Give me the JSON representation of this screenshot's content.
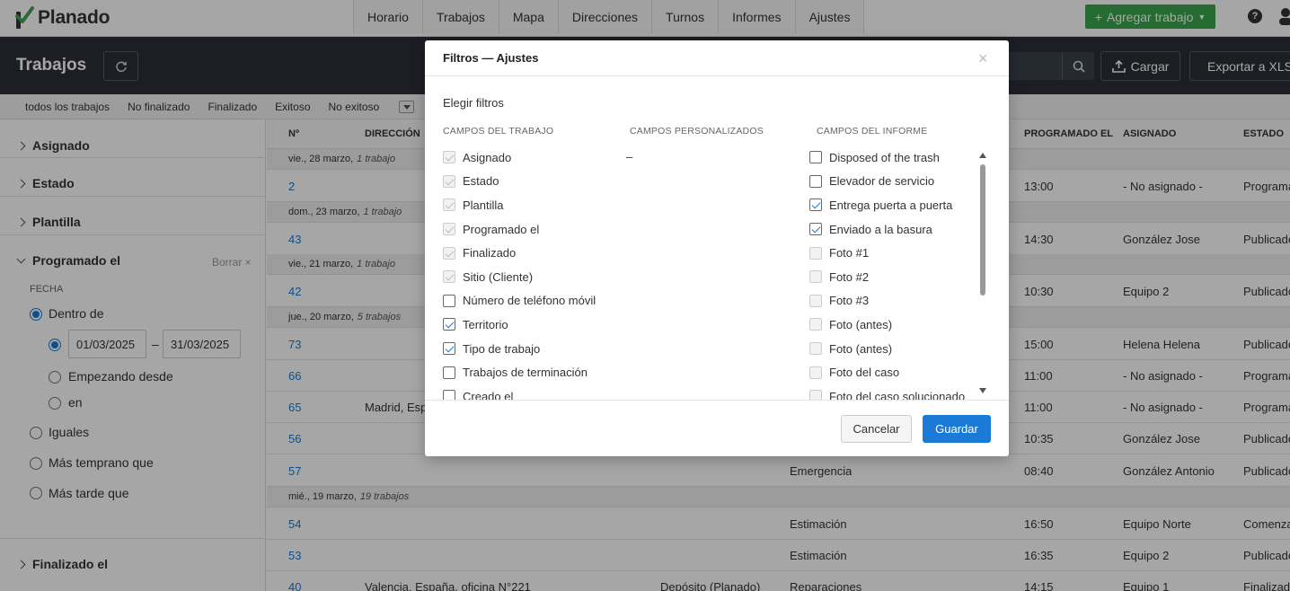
{
  "app": {
    "name": "Planado"
  },
  "nav": {
    "tabs": [
      "Horario",
      "Trabajos",
      "Mapa",
      "Direcciones",
      "Turnos",
      "Informes",
      "Ajustes"
    ],
    "add_job": "Agregar trabajo",
    "help": "?"
  },
  "header": {
    "title": "Trabajos",
    "upload": "Cargar",
    "export": "Exportar a XLS"
  },
  "filters": {
    "chips": [
      "todos los trabajos",
      "No finalizado",
      "Finalizado",
      "Exitoso",
      "No exitoso"
    ]
  },
  "left": {
    "assigned": "Asignado",
    "status": "Estado",
    "template": "Plantilla",
    "scheduled": "Programado el",
    "clear": "Borrar ×",
    "date_label": "FECHA",
    "within": "Dentro de",
    "date_from": "01/03/2025",
    "date_sep": "–",
    "date_to": "31/03/2025",
    "starting": "Empezando desde",
    "on": "en",
    "equals": "Iguales",
    "earlier": "Más temprano que",
    "later": "Más tarde que",
    "finished": "Finalizado el"
  },
  "table": {
    "headers": {
      "num": "Nº",
      "address": "DIRECCIÓN",
      "scheduled": "PROGRAMADO EL",
      "assigned": "ASIGNADO",
      "status": "ESTADO"
    },
    "groups": [
      {
        "date": "vie., 28 marzo,",
        "count": "1 trabajo"
      },
      {
        "date": "dom., 23 marzo,",
        "count": "1 trabajo"
      },
      {
        "date": "vie., 21 marzo,",
        "count": "1 trabajo"
      },
      {
        "date": "jue., 20 marzo,",
        "count": "5 trabajos"
      },
      {
        "date": "mié., 19 marzo,",
        "count": "19 trabajos"
      }
    ],
    "rows": [
      {
        "num": "2",
        "address": "",
        "site": "",
        "type": "",
        "time": "13:00",
        "assignee": "- No asignado -",
        "status": "Programado"
      },
      {
        "num": "43",
        "address": "",
        "site": "",
        "type": "",
        "time": "14:30",
        "assignee": "González Jose",
        "status": "Publicado"
      },
      {
        "num": "42",
        "address": "",
        "site": "",
        "type": "",
        "time": "10:30",
        "assignee": "Equipo 2",
        "status": "Publicado"
      },
      {
        "num": "73",
        "address": "",
        "site": "",
        "type": "",
        "time": "15:00",
        "assignee": "Helena Helena",
        "status": "Publicado"
      },
      {
        "num": "66",
        "address": "",
        "site": "",
        "type": "",
        "time": "11:00",
        "assignee": "- No asignado -",
        "status": "Programado"
      },
      {
        "num": "65",
        "address": "Madrid, Esp",
        "site": "",
        "type": "",
        "time": "11:00",
        "assignee": "- No asignado -",
        "status": "Programado"
      },
      {
        "num": "56",
        "address": "",
        "site": "",
        "type": "",
        "time": "10:35",
        "assignee": "González Jose",
        "status": "Publicado"
      },
      {
        "num": "57",
        "address": "",
        "site": "",
        "type": "Emergencia",
        "time": "08:40",
        "assignee": "González Antonio",
        "status": "Publicado"
      },
      {
        "num": "54",
        "address": "",
        "site": "",
        "type": "Estimación",
        "time": "16:50",
        "assignee": "Equipo Norte",
        "status": "Comenzado"
      },
      {
        "num": "53",
        "address": "",
        "site": "",
        "type": "Estimación",
        "time": "16:35",
        "assignee": "Equipo 2",
        "status": "Publicado"
      },
      {
        "num": "40",
        "address": "Valencia, España, oficina N°221",
        "site": "Depósito (Planado)",
        "type": "Reparaciones",
        "time": "14:15",
        "assignee": "Equipo 1",
        "status": "Finalizado"
      }
    ]
  },
  "modal": {
    "title": "Filtros — Ajustes",
    "close": "×",
    "subtitle": "Elegir filtros",
    "col_job": "CAMPOS DEL TRABAJO",
    "col_custom": "CAMPOS PERSONALIZADOS",
    "col_report": "CAMPOS DEL INFORME",
    "custom_empty": "–",
    "job_fields": [
      {
        "label": "Asignado",
        "checked": true,
        "disabled": true
      },
      {
        "label": "Estado",
        "checked": true,
        "disabled": true
      },
      {
        "label": "Plantilla",
        "checked": true,
        "disabled": true
      },
      {
        "label": "Programado el",
        "checked": true,
        "disabled": true
      },
      {
        "label": "Finalizado",
        "checked": true,
        "disabled": true
      },
      {
        "label": "Sitio (Cliente)",
        "checked": true,
        "disabled": true
      },
      {
        "label": "Número de teléfono móvil",
        "checked": false,
        "disabled": false
      },
      {
        "label": "Territorio",
        "checked": true,
        "disabled": false
      },
      {
        "label": "Tipo de trabajo",
        "checked": true,
        "disabled": false
      },
      {
        "label": "Trabajos de terminación",
        "checked": false,
        "disabled": false
      },
      {
        "label": "Creado el",
        "checked": false,
        "disabled": false
      }
    ],
    "report_fields": [
      {
        "label": "Disposed of the trash",
        "checked": false,
        "disabled": false
      },
      {
        "label": "Elevador de servicio",
        "checked": false,
        "disabled": false
      },
      {
        "label": "Entrega puerta a puerta",
        "checked": true,
        "disabled": false
      },
      {
        "label": "Enviado a la basura",
        "checked": true,
        "disabled": false
      },
      {
        "label": "Foto #1",
        "checked": false,
        "disabled": true
      },
      {
        "label": "Foto #2",
        "checked": false,
        "disabled": true
      },
      {
        "label": "Foto #3",
        "checked": false,
        "disabled": true
      },
      {
        "label": "Foto (antes)",
        "checked": false,
        "disabled": true
      },
      {
        "label": "Foto (antes)",
        "checked": false,
        "disabled": true
      },
      {
        "label": "Foto del caso",
        "checked": false,
        "disabled": true
      },
      {
        "label": "Foto del caso solucionado",
        "checked": false,
        "disabled": true
      }
    ],
    "cancel": "Cancelar",
    "save": "Guardar"
  },
  "colors": {
    "accent": "#1a7ad6",
    "green": "#3ba54c",
    "dark": "#2b2f38"
  }
}
